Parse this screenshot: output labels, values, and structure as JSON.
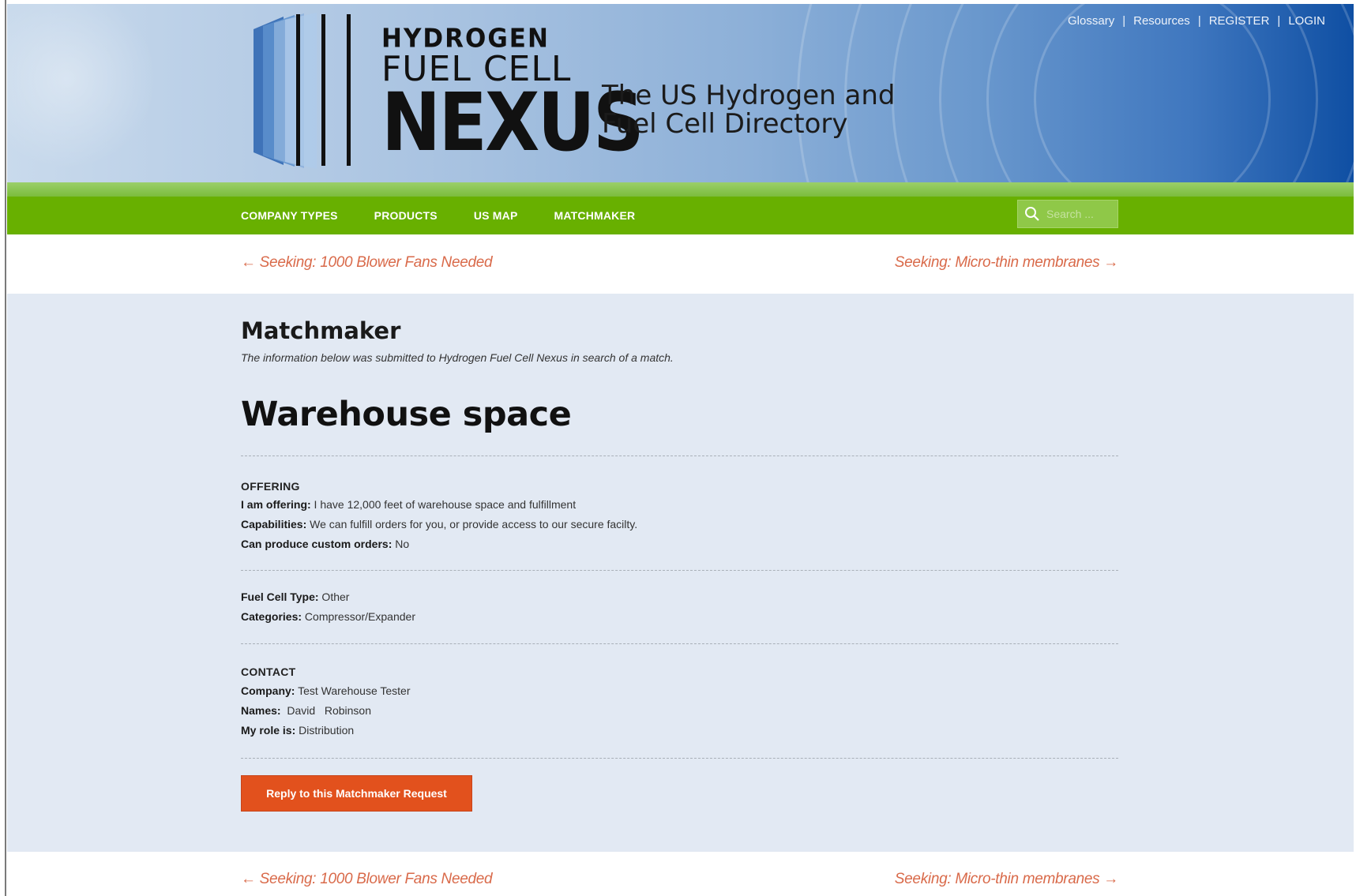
{
  "header": {
    "logo": {
      "line1": "HYDROGEN",
      "line2": "FUEL CELL",
      "line3": "NEXUS"
    },
    "tagline": {
      "line1": "The US Hydrogen and",
      "line2": "Fuel Cell Directory"
    },
    "top_links": {
      "glossary": "Glossary",
      "resources": "Resources",
      "register": "REGISTER",
      "login": "LOGIN",
      "separator": "|"
    }
  },
  "nav": {
    "items": [
      "COMPANY TYPES",
      "PRODUCTS",
      "US MAP",
      "MATCHMAKER"
    ],
    "search_placeholder": "Search ..."
  },
  "post_nav": {
    "prev": "← Seeking: 1000 Blower Fans Needed",
    "next": "Seeking: Micro-thin membranes →"
  },
  "main": {
    "heading": "Matchmaker",
    "intro": "The information below was submitted to Hydrogen Fuel Cell Nexus in search of a match.",
    "title": "Warehouse space",
    "offering": {
      "section_label": "OFFERING",
      "offering_label": "I am offering:",
      "offering_value": " I have 12,000 feet of warehouse space and fulfillment",
      "capabilities_label": "Capabilities:",
      "capabilities_value": " We can fulfill orders for you, or provide access to our secure facilty.",
      "custom_label": "Can produce custom orders:",
      "custom_value": " No"
    },
    "details": {
      "fuel_cell_label": "Fuel Cell Type:",
      "fuel_cell_value": " Other",
      "categories_label": "Categories:",
      "categories_value": " Compressor/Expander"
    },
    "contact": {
      "section_label": "CONTACT",
      "company_label": "Company:",
      "company_value": " Test Warehouse Tester",
      "names_label": "Names:",
      "names_value": "  David   Robinson",
      "role_label": "My role is:",
      "role_value": " Distribution"
    },
    "reply_button": "Reply to this Matchmaker Request"
  },
  "colors": {
    "nav_green": "#68b000",
    "accent_orange": "#e2511d",
    "link_salmon": "#d96a4a",
    "content_bg": "#e2e9f3",
    "header_blue": "#0f4fa3"
  },
  "icons": {
    "search": "search-icon",
    "logo": "logo-bars-icon"
  }
}
